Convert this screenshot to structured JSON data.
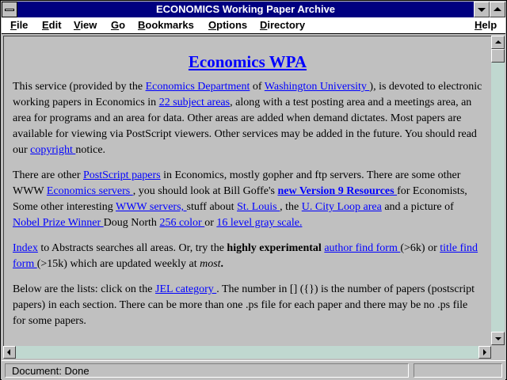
{
  "window": {
    "title": "ECONOMICS Working Paper Archive"
  },
  "menu": [
    {
      "label": "File",
      "u": "F",
      "rest": "ile"
    },
    {
      "label": "Edit",
      "u": "E",
      "rest": "dit"
    },
    {
      "label": "View",
      "u": "V",
      "rest": "iew"
    },
    {
      "label": "Go",
      "u": "G",
      "rest": "o"
    },
    {
      "label": "Bookmarks",
      "u": "B",
      "rest": "ookmarks"
    },
    {
      "label": "Options",
      "u": "O",
      "rest": "ptions"
    },
    {
      "label": "Directory",
      "u": "D",
      "rest": "irectory"
    },
    {
      "label": "Help",
      "u": "H",
      "rest": "elp"
    }
  ],
  "page": {
    "heading": "Economics WPA",
    "p1": {
      "t1": "This service (provided by the ",
      "l1": "Economics Department",
      "t2": " of ",
      "l2": "Washington University ",
      "t3": "), is devoted to electronic working papers in Economics in ",
      "l3": "22 subject areas",
      "t4": ", along with a test posting area and a meetings area, an area for programs and an area for data. Other areas are added when demand dictates. Most papers are available for viewing via PostScript viewers. Other services may be added in the future. You should read our ",
      "l4": "copyright ",
      "t5": "notice."
    },
    "p2": {
      "t1": "There are other ",
      "l1": "PostScript papers",
      "t2": " in Economics, mostly gopher and ftp servers. There are some other WWW ",
      "l2": "Economics servers ",
      "t3": ", you should look at Bill Goffe's ",
      "l3": "new Version 9 Resources ",
      "t4": "for Economists, Some other interesting ",
      "l4": "WWW servers, ",
      "t5": "stuff about ",
      "l5": "St. Louis ",
      "t6": ", the ",
      "l6": "U. City Loop area",
      "t7": " and a picture of ",
      "l7": "Nobel Prize Winner ",
      "t8": "Doug North ",
      "l8": "256 color ",
      "t9": "or ",
      "l9": "16 level gray scale. "
    },
    "p3": {
      "l1": "Index",
      "t1": " to Abstracts searches all areas. Or, try the ",
      "b1": "highly experimental",
      "t2": " ",
      "l2": "author find form ",
      "t3": "(>6k) or ",
      "l3": "title find form ",
      "t4": "(>15k) which are updated weekly at ",
      "i1": "most",
      "t5": "."
    },
    "p4": {
      "t1": "Below are the lists: click on the ",
      "l1": "JEL category ",
      "t2": ". The number in [] ({}) is the number of papers (postscript papers) in each section. There can be more than one .ps file for each paper and there may be no .ps file for some papers."
    }
  },
  "status": {
    "text": "Document: Done"
  }
}
